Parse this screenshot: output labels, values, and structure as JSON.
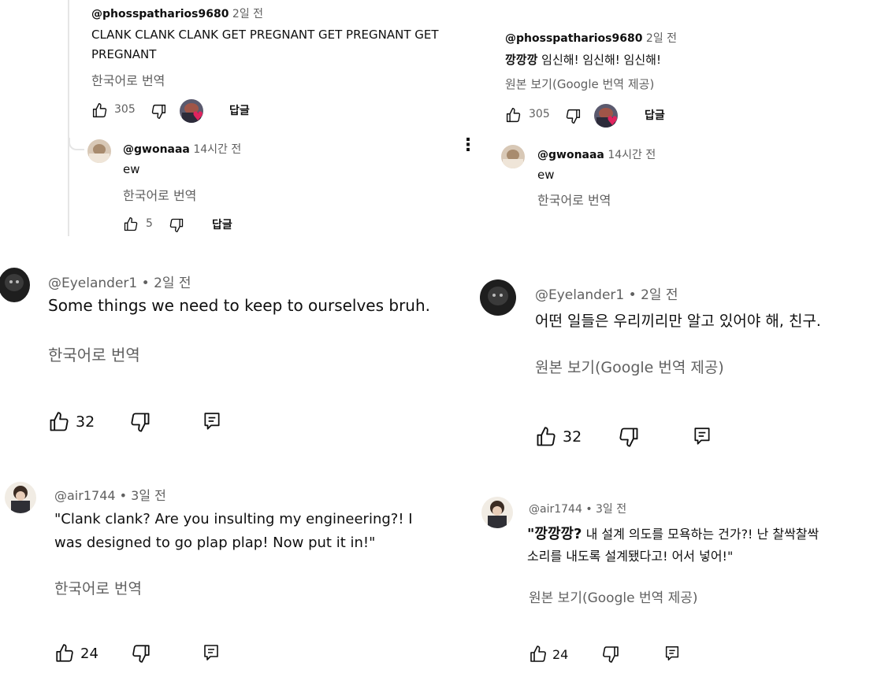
{
  "panel_left": {
    "top_comment": {
      "handle": "@phosspatharios9680",
      "time": "2일 전",
      "text_line1": "CLANK CLANK CLANK GET PREGNANT GET PREGNANT GET",
      "text_line2": "PREGNANT",
      "translate": "한국어로 번역",
      "likes": "305",
      "reply": "답글"
    },
    "reply_comment": {
      "handle": "@gwonaaa",
      "time": "14시간 전",
      "text": "ew",
      "translate": "한국어로 번역",
      "likes": "5",
      "reply": "답글"
    },
    "comment_eyelander": {
      "handle": "@Eyelander1",
      "time": "• 2일 전",
      "text": "Some things we need to keep to ourselves bruh.",
      "translate": "한국어로 번역",
      "likes": "32"
    },
    "comment_air": {
      "handle": "@air1744",
      "time": "• 3일 전",
      "text_line1": "\"Clank clank? Are you insulting my engineering?! I",
      "text_line2": "was designed to go plap plap! Now put it in!\"",
      "translate": "한국어로 번역",
      "likes": "24"
    }
  },
  "panel_right": {
    "top_comment": {
      "handle": "@phosspatharios9680",
      "time": "2일 전",
      "text_bold": "깡깡깡",
      "text_rest": " 임신해! 임신해! 임신해!",
      "view_original": "원본 보기(Google 번역 제공)",
      "likes": "305",
      "reply": "답글"
    },
    "reply_comment": {
      "handle": "@gwonaaa",
      "time": "14시간 전",
      "text": "ew",
      "translate": "한국어로 번역"
    },
    "comment_eyelander": {
      "handle": "@Eyelander1",
      "time": "• 2일 전",
      "text": "어떤 일들은 우리끼리만 알고 있어야 해, 친구.",
      "view_original": "원본 보기(Google 번역 제공)",
      "likes": "32"
    },
    "comment_air": {
      "handle": "@air1744",
      "time": "• 3일 전",
      "text_bold": "\"깡깡깡?",
      "text_rest1": " 내 설계 의도를 모욕하는 건가?! 난 찰싹찰싹",
      "text_line2": "소리를 내도록 설계됐다고! 어서 넣어!\"",
      "view_original": "원본 보기(Google 번역 제공)",
      "likes": "24"
    }
  },
  "colors": {
    "text": "#0f0f0f",
    "muted": "#606060",
    "heart": "#e0245e",
    "thread_line": "#e5e5e5"
  },
  "icons": [
    "thumbs-up-icon",
    "thumbs-down-icon",
    "reply-comment-icon",
    "more-vert-icon",
    "creator-heart-icon"
  ]
}
